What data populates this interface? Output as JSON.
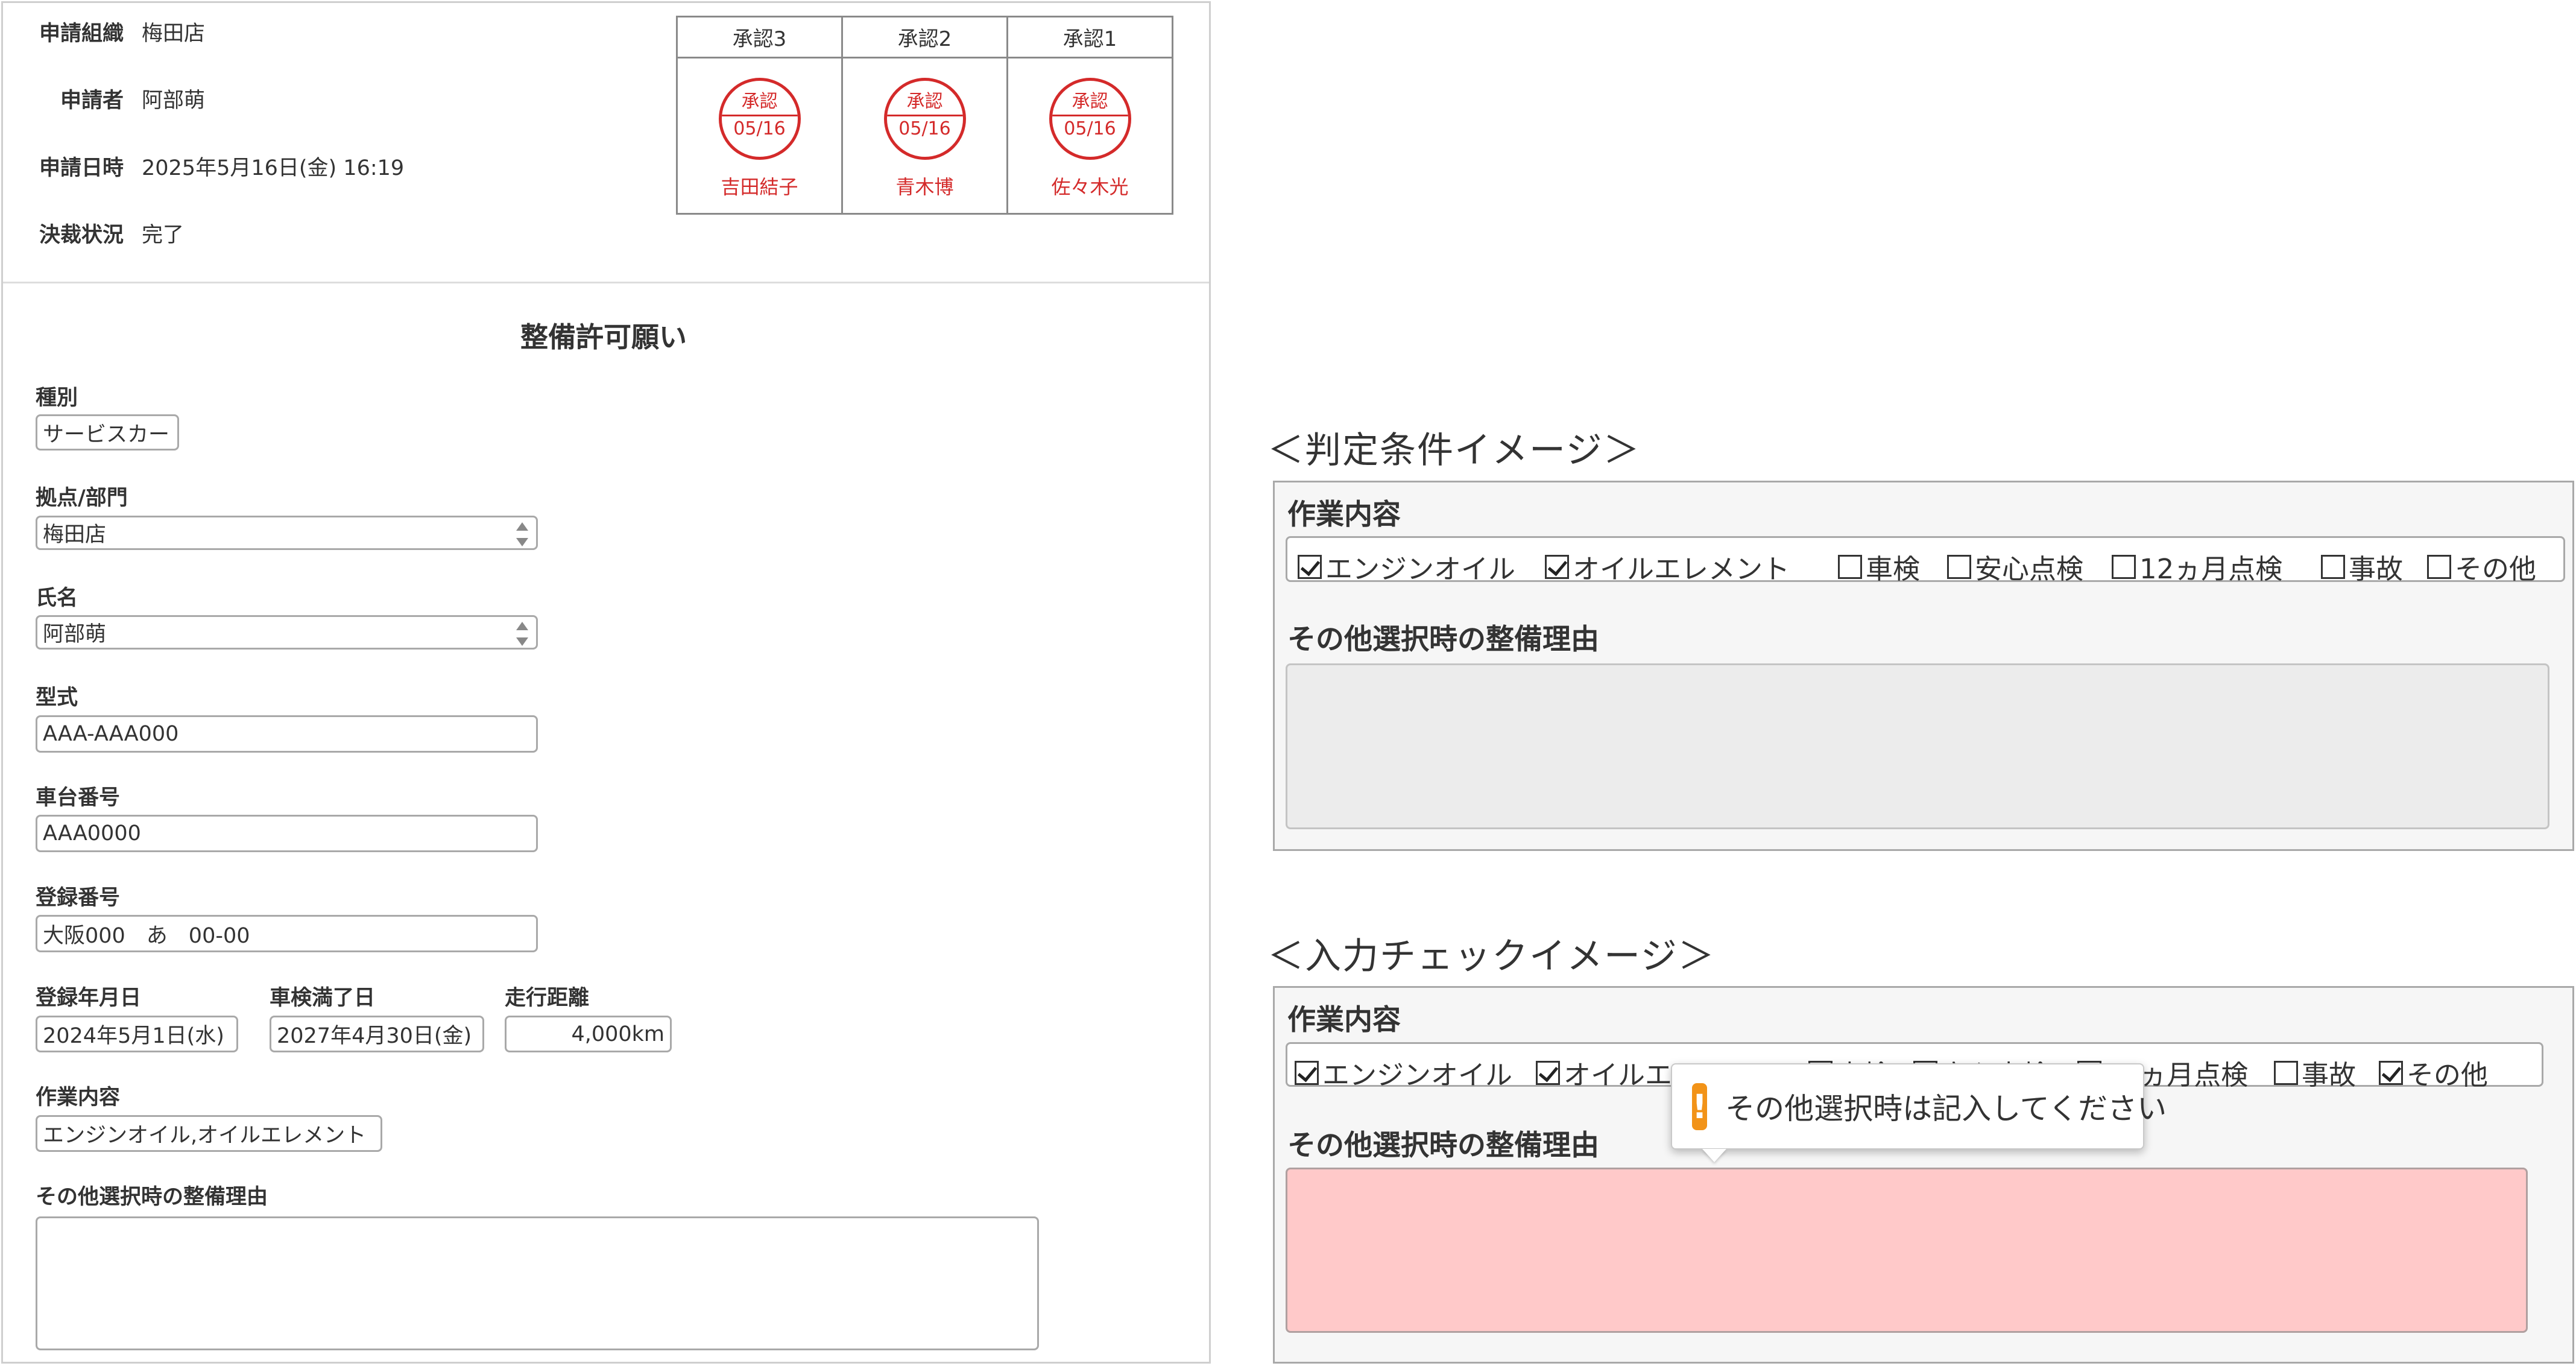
{
  "header": {
    "fields": [
      {
        "label": "申請組織",
        "value": "梅田店"
      },
      {
        "label": "申請者",
        "value": "阿部萌"
      },
      {
        "label": "申請日時",
        "value": "2025年5月16日(金) 16:19"
      },
      {
        "label": "決裁状況",
        "value": "完了"
      }
    ],
    "approvals": [
      {
        "heading": "承認3",
        "stamp_text": "承認",
        "date": "05/16",
        "name": "吉田結子"
      },
      {
        "heading": "承認2",
        "stamp_text": "承認",
        "date": "05/16",
        "name": "青木博"
      },
      {
        "heading": "承認1",
        "stamp_text": "承認",
        "date": "05/16",
        "name": "佐々木光"
      }
    ],
    "stamp_color": "#d42a2a"
  },
  "form": {
    "title": "整備許可願い",
    "type": {
      "label": "種別",
      "value": "サービスカー"
    },
    "branch": {
      "label": "拠点/部門",
      "value": "梅田店"
    },
    "name": {
      "label": "氏名",
      "value": "阿部萌"
    },
    "model": {
      "label": "型式",
      "value": "AAA-AAA000"
    },
    "chassis": {
      "label": "車台番号",
      "value": "AAA0000"
    },
    "registration": {
      "label": "登録番号",
      "value": "大阪000　あ　00-00"
    },
    "reg_date": {
      "label": "登録年月日",
      "value": "2024年5月1日(水)"
    },
    "inspection_expiry": {
      "label": "車検満了日",
      "value": "2027年4月30日(金)"
    },
    "mileage": {
      "label": "走行距離",
      "value": "4,000km"
    },
    "work": {
      "label": "作業内容",
      "value": "エンジンオイル,オイルエレメント"
    },
    "other_reason": {
      "label": "その他選択時の整備理由",
      "value": ""
    }
  },
  "judge_example": {
    "caption": "＜判定条件イメージ＞",
    "section_label": "作業内容",
    "options": [
      {
        "label": "エンジンオイル",
        "checked": true
      },
      {
        "label": "オイルエレメント",
        "checked": true
      },
      {
        "label": "車検",
        "checked": false
      },
      {
        "label": "安心点検",
        "checked": false
      },
      {
        "label": "12ヵ月点検",
        "checked": false
      },
      {
        "label": "事故",
        "checked": false
      },
      {
        "label": "その他",
        "checked": false
      }
    ],
    "reason_label": "その他選択時の整備理由"
  },
  "input_check_example": {
    "caption": "＜入力チェックイメージ＞",
    "section_label": "作業内容",
    "options": [
      {
        "label": "エンジンオイル",
        "checked": true
      },
      {
        "label": "オイルエレメント",
        "checked": true
      },
      {
        "label": "車検",
        "checked": false
      },
      {
        "label": "安心点検",
        "checked": false
      },
      {
        "label": "12ヵ月点検",
        "checked": false
      },
      {
        "label": "事故",
        "checked": false
      },
      {
        "label": "その他",
        "checked": true
      }
    ],
    "reason_label": "その他選択時の整備理由",
    "tooltip": {
      "icon": "!",
      "text": "その他選択時は記入してください"
    },
    "error_color": "#ffc9c9",
    "warning_color": "#f29318"
  }
}
